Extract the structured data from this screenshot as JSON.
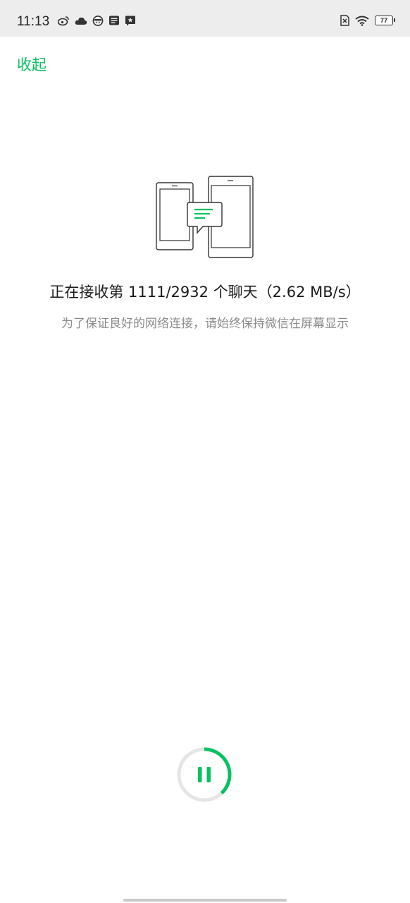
{
  "status_bar": {
    "time": "11:13",
    "battery_level": "77",
    "left_icons": [
      "weibo-icon",
      "cloud-icon",
      "app-face-icon",
      "message-icon",
      "star-badge-icon"
    ],
    "right_icons": [
      "no-sim-icon",
      "wifi-icon",
      "battery-icon"
    ]
  },
  "header": {
    "collapse_label": "收起"
  },
  "transfer": {
    "label_prefix": "正在接收第",
    "current": "1111",
    "total": "2932",
    "label_suffix": "个聊天",
    "speed": "（2.62 MB/s）",
    "hint": "为了保证良好的网络连接，请始终保持微信在屏幕显示",
    "progress": 0.38
  },
  "colors": {
    "accent": "#07c160",
    "ring_track": "#e5e5e5",
    "status_bar_bg": "#ededed"
  }
}
